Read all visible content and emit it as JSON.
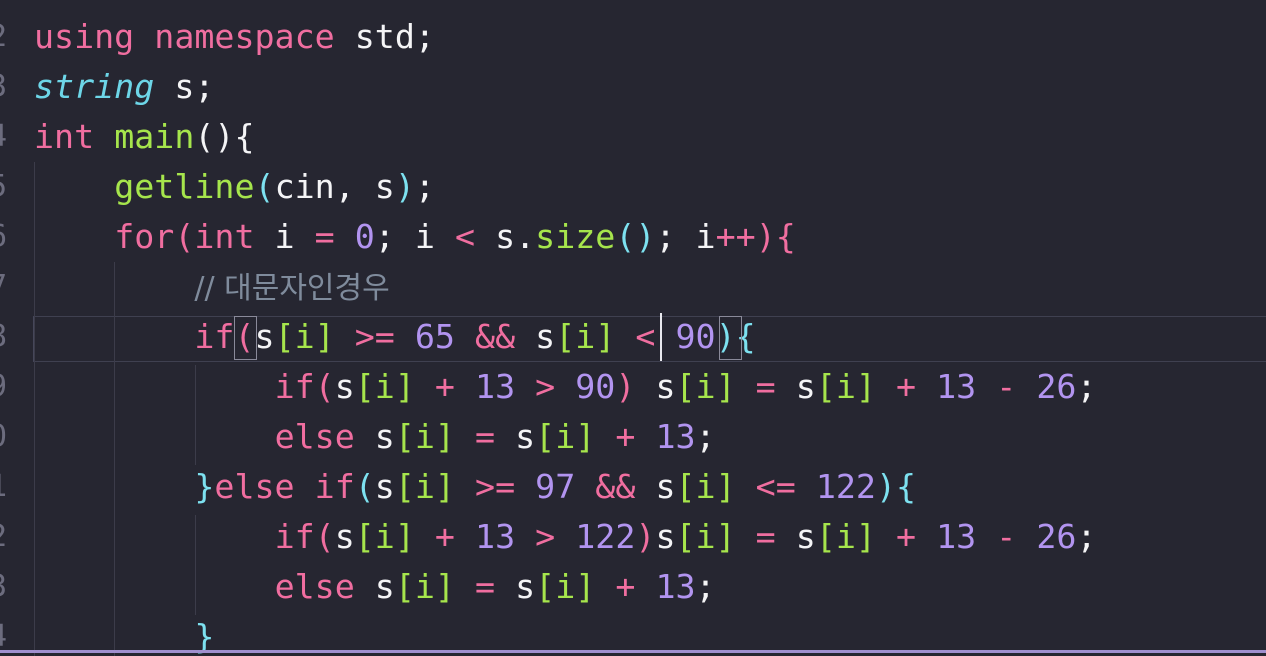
{
  "gutter": {
    "line_numbers": [
      "2",
      "3",
      "4",
      "5",
      "6",
      "7",
      "8",
      "9",
      "0",
      "1",
      "2",
      "3",
      "4"
    ]
  },
  "code": {
    "l1": {
      "kw1": "using",
      "kw2": "namespace",
      "rest": " std;"
    },
    "l2": {
      "ty": "string",
      "rest": " s;"
    },
    "l3": {
      "ty": "int",
      "fn": "main",
      "paren": "()",
      "brace": "{"
    },
    "l4": {
      "fn": "getline",
      "p1": "(",
      "args": "cin, s",
      "p2": ")",
      "semi": ";"
    },
    "l5": {
      "kw": "for",
      "p1": "(",
      "ty": "int",
      "a": " i ",
      "eq": "=",
      "b": " ",
      "n0": "0",
      "c": "; i ",
      "lt": "<",
      "d": " s.",
      "fn": "size",
      "p2": "()",
      "e": "; i",
      "pp": "++",
      "p3": ")",
      "brace": "{"
    },
    "l6": {
      "comment": "// 대문자인경우"
    },
    "l7": {
      "kw": "if",
      "p1": "(",
      "s1": "s",
      "i1": "[i]",
      "sp1": " ",
      "ge": ">=",
      "sp2": " ",
      "n65": "65",
      "sp3": " ",
      "and": "&&",
      "sp4": " ",
      "s2": "s",
      "i2": "[i]",
      "sp5": " ",
      "lt": "<",
      "sp6": " ",
      "n90": "90",
      "p2": ")",
      "brace": "{"
    },
    "l8": {
      "kw": "if",
      "p1": "(",
      "s1": "s",
      "i1": "[i]",
      "plus1": " + ",
      "n13a": "13",
      "gt": " > ",
      "n90": "90",
      "p2": ")",
      "s2": " s",
      "i2": "[i]",
      "eq": " = ",
      "s3": "s",
      "i3": "[i]",
      "plus2": " + ",
      "n13b": "13",
      "minus": " - ",
      "n26": "26",
      "semi": ";"
    },
    "l9": {
      "kw": "else",
      "s1": " s",
      "i1": "[i]",
      "eq": " = ",
      "s2": "s",
      "i2": "[i]",
      "plus": " + ",
      "n13": "13",
      "semi": ";"
    },
    "l10": {
      "brace1": "}",
      "kw": "else if",
      "p1": "(",
      "s1": "s",
      "i1": "[i]",
      "ge": " >= ",
      "n97": "97",
      "and": " && ",
      "s2": "s",
      "i2": "[i]",
      "le": " <= ",
      "n122": "122",
      "p2": ")",
      "brace2": "{"
    },
    "l11": {
      "kw": "if",
      "p1": "(",
      "s1": "s",
      "i1": "[i]",
      "plus1": " + ",
      "n13a": "13",
      "gt": " > ",
      "n122": "122",
      "p2": ")",
      "s2": "s",
      "i2": "[i]",
      "eq": " = ",
      "s3": "s",
      "i3": "[i]",
      "plus2": " + ",
      "n13b": "13",
      "minus": " - ",
      "n26": "26",
      "semi": ";"
    },
    "l12": {
      "kw": "else",
      "s1": " s",
      "i1": "[i]",
      "eq": " = ",
      "s2": "s",
      "i2": "[i]",
      "plus": " + ",
      "n13": "13",
      "semi": ";"
    },
    "l13": {
      "brace": "}"
    }
  },
  "colors": {
    "background": "#262631",
    "keyword": "#f06ea0",
    "function": "#a6e54c",
    "number": "#b294f0",
    "bracket": "#7de1f0",
    "comment": "#7f8b9c"
  }
}
